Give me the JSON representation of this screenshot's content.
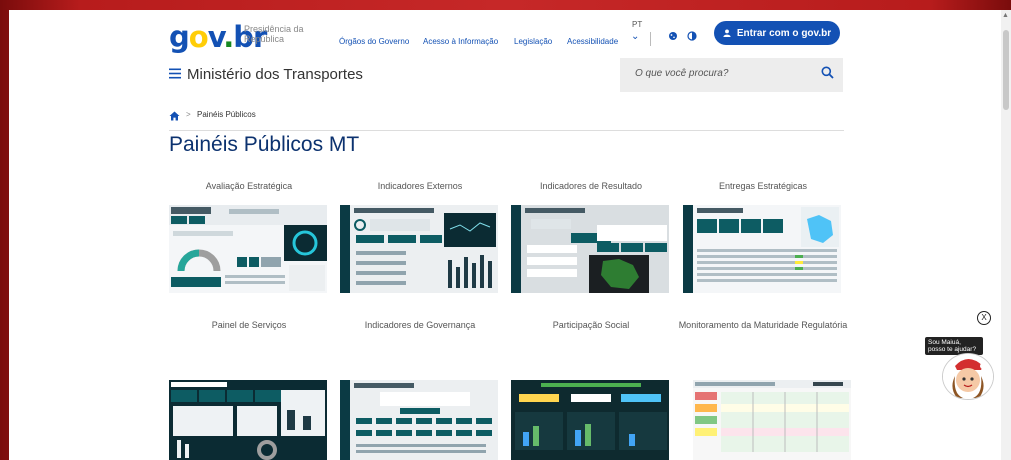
{
  "header": {
    "presidencia": "Presidência da República",
    "nav": [
      "Órgãos do Governo",
      "Acesso à Informação",
      "Legislação",
      "Acessibilidade"
    ],
    "lang": "PT",
    "login_label": "Entrar com o gov.br",
    "ministry": "Ministério dos Transportes",
    "search_placeholder": "O que você procura?"
  },
  "breadcrumb": {
    "current": "Painéis Públicos"
  },
  "page_title": "Painéis Públicos MT",
  "panels": [
    {
      "label": "Avaliação Estratégica"
    },
    {
      "label": "Indicadores Externos"
    },
    {
      "label": "Indicadores de Resultado"
    },
    {
      "label": "Entregas Estratégicas"
    },
    {
      "label": "Painel de Serviços"
    },
    {
      "label": "Indicadores de Governança"
    },
    {
      "label": "Participação Social"
    },
    {
      "label": "Monitoramento da Maturidade Regulatória"
    }
  ],
  "chat": {
    "bubble": "Sou Maiuá, posso te ajudar?",
    "close": "X"
  },
  "colors": {
    "primary": "#1351b4",
    "title": "#0c326f",
    "background_red": "#c62828"
  }
}
